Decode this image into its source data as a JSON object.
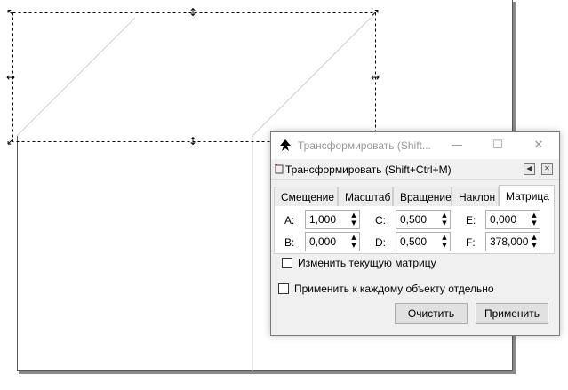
{
  "canvas": {
    "handles": {
      "corner_nw": "↖",
      "corner_ne": "↗",
      "corner_sw": "↙",
      "scale_h": "↔",
      "scale_v": "↕"
    }
  },
  "dialog": {
    "window_title": "Трансформировать (Shift...",
    "window_buttons": {
      "minimize": "—",
      "maximize": "☐",
      "close": "✕"
    },
    "dock_title": "Трансформировать (Shift+Ctrl+M)",
    "dock_buttons": {
      "collapse": "◀",
      "close": "✕"
    },
    "tabs": [
      {
        "label": "Смещение",
        "active": false
      },
      {
        "label": "Масштаб",
        "active": false
      },
      {
        "label": "Вращение",
        "active": false
      },
      {
        "label": "Наклон",
        "active": false
      },
      {
        "label": "Матрица",
        "active": true
      }
    ],
    "matrix": {
      "a": {
        "label": "A:",
        "value": "1,000"
      },
      "b": {
        "label": "B:",
        "value": "0,000"
      },
      "c": {
        "label": "C:",
        "value": "0,500"
      },
      "d": {
        "label": "D:",
        "value": "0,500"
      },
      "e": {
        "label": "E:",
        "value": "0,000"
      },
      "f": {
        "label": "F:",
        "value": "378,000"
      }
    },
    "edit_current_matrix": {
      "label": "Изменить текущую матрицу",
      "checked": false
    },
    "apply_separately": {
      "label": "Применить к каждому объекту отдельно",
      "checked": false
    },
    "clear_label": "Очистить",
    "apply_label": "Применить",
    "spin_up": "▲",
    "spin_down": "▼"
  }
}
